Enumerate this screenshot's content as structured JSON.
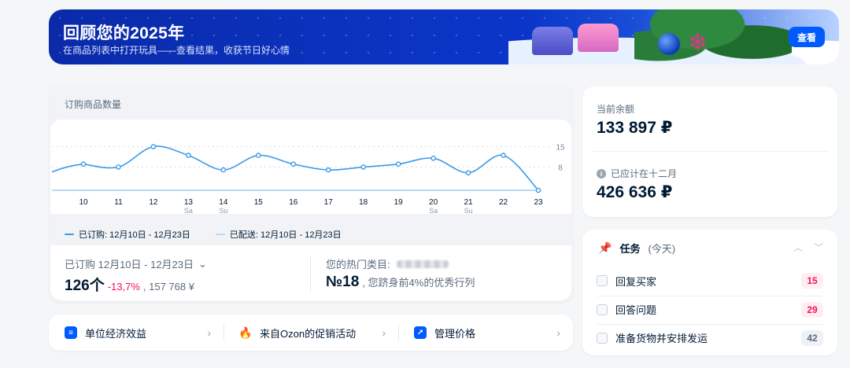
{
  "banner": {
    "title": "回顾您的2025年",
    "subtitle": "在商品列表中打开玩具——查看结果，收获节日好心情",
    "button": "查看"
  },
  "chart_card": {
    "title": "订购商品数量",
    "legend": [
      {
        "label": "已订购:  12月10日 - 12月23日",
        "color": "#3b9ae8"
      },
      {
        "label": "已配送:  12月10日 - 12月23日",
        "color": "#b5dbfa"
      }
    ]
  },
  "chart_data": {
    "type": "line",
    "x": [
      "10",
      "11",
      "12",
      "13",
      "14",
      "15",
      "16",
      "17",
      "18",
      "19",
      "20",
      "21",
      "22",
      "23"
    ],
    "x_sub": [
      "",
      "",
      "",
      "Sa",
      "Su",
      "",
      "",
      "",
      "",
      "",
      "Sa",
      "Su",
      "",
      ""
    ],
    "series": [
      {
        "values": [
          9,
          8,
          15,
          12,
          7,
          12,
          9,
          7,
          8,
          9,
          11,
          6,
          12,
          0
        ],
        "color": "#3b9ae8"
      },
      {
        "values": [
          0,
          0,
          0,
          0,
          0,
          0,
          0,
          0,
          0,
          0,
          0,
          0,
          0,
          0
        ],
        "color": "#b5dbfa"
      }
    ],
    "yticks": [
      8,
      15
    ],
    "ylim": [
      0,
      20
    ]
  },
  "stats": {
    "ordered_label": "已订购  12月10日 - 12月23日",
    "ordered_count": "126个",
    "ordered_change": "-13,7%",
    "ordered_amount": ", 157 768 ¥",
    "hot_label": "您的热门类目:",
    "hot_rank": "№18",
    "hot_desc": ", 您跻身前4%的优秀行列"
  },
  "links": [
    {
      "label": "单位经济效益",
      "icon": "document-icon"
    },
    {
      "label": "来自Ozon的促销活动",
      "icon": "flame-icon"
    },
    {
      "label": "管理价格",
      "icon": "trend-icon"
    }
  ],
  "balance": {
    "current_label": "当前余额",
    "current_value": "133 897 ₽",
    "expected_label": "已应计在十二月",
    "expected_value": "426 636 ₽"
  },
  "tasks": {
    "title": "任务",
    "period": "(今天)",
    "items": [
      {
        "label": "回复买家",
        "count": "15",
        "tone": "red"
      },
      {
        "label": "回答问题",
        "count": "29",
        "tone": "red"
      },
      {
        "label": "准备货物并安排发运",
        "count": "42",
        "tone": "gray"
      }
    ]
  }
}
